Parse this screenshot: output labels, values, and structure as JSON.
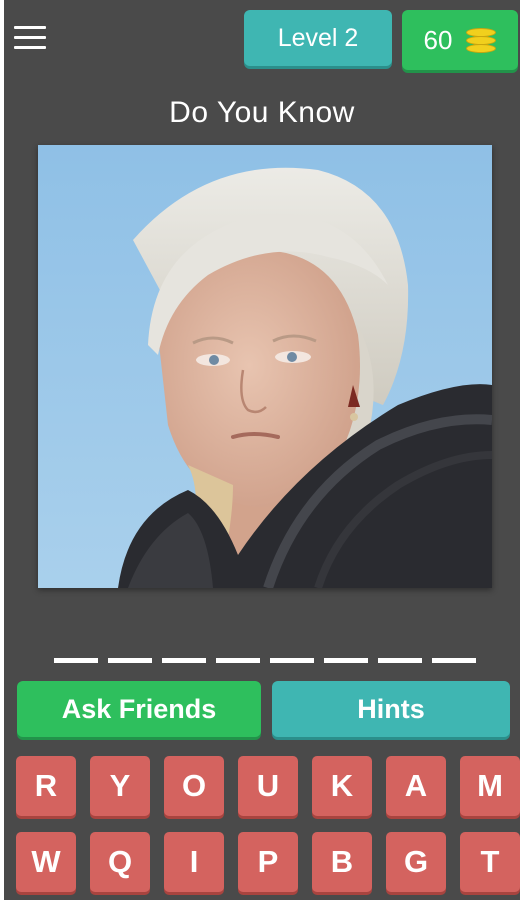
{
  "header": {
    "level_label": "Level 2",
    "coins": "60"
  },
  "title": "Do You Know",
  "answer_slots": 8,
  "buttons": {
    "ask_friends": "Ask Friends",
    "hints": "Hints"
  },
  "keyboard": {
    "keys": [
      "R",
      "Y",
      "O",
      "U",
      "K",
      "A",
      "M",
      "W",
      "Q",
      "I",
      "P",
      "B",
      "G",
      "T"
    ]
  },
  "colors": {
    "background": "#4a4a4a",
    "teal": "#3fb6b2",
    "green": "#2ebf5d",
    "key_red": "#d4635f",
    "coin_yellow": "#f1d01d"
  },
  "icons": [
    "menu-icon",
    "coin-stack-icon"
  ]
}
